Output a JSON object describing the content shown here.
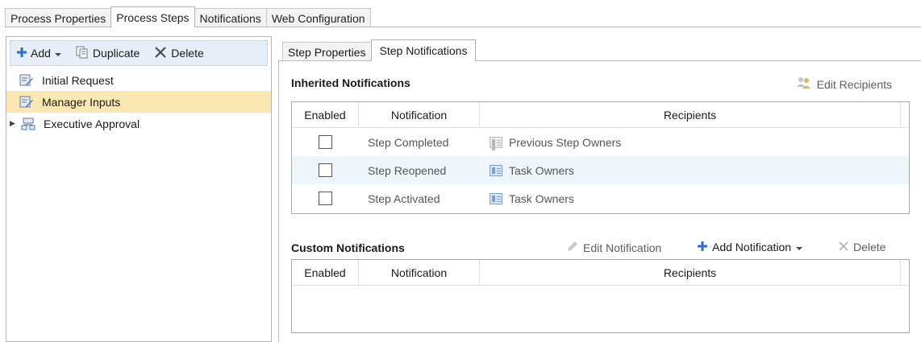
{
  "top_tabs": [
    "Process Properties",
    "Process Steps",
    "Notifications",
    "Web Configuration"
  ],
  "left_toolbar": {
    "add": "Add",
    "duplicate": "Duplicate",
    "delete": "Delete"
  },
  "tree": {
    "items": [
      {
        "label": "Initial Request"
      },
      {
        "label": "Manager Inputs"
      },
      {
        "label": "Executive Approval"
      }
    ]
  },
  "sub_tabs": [
    "Step Properties",
    "Step Notifications"
  ],
  "inherited": {
    "title": "Inherited Notifications",
    "edit_recipients": "Edit Recipients",
    "columns": [
      "Enabled",
      "Notification",
      "Recipients"
    ],
    "rows": [
      {
        "notification": "Step Completed",
        "recipients": "Previous Step Owners"
      },
      {
        "notification": "Step Reopened",
        "recipients": "Task Owners"
      },
      {
        "notification": "Step Activated",
        "recipients": "Task Owners"
      }
    ]
  },
  "custom": {
    "title": "Custom Notifications",
    "edit_notification": "Edit Notification",
    "add_notification": "Add Notification",
    "delete": "Delete",
    "columns": [
      "Enabled",
      "Notification",
      "Recipients"
    ]
  },
  "colors": {
    "selected_row": "#fbe7b2",
    "highlight": "#fcf54e",
    "alt_row": "#eef5fb",
    "accent": "#2a6fc9"
  }
}
